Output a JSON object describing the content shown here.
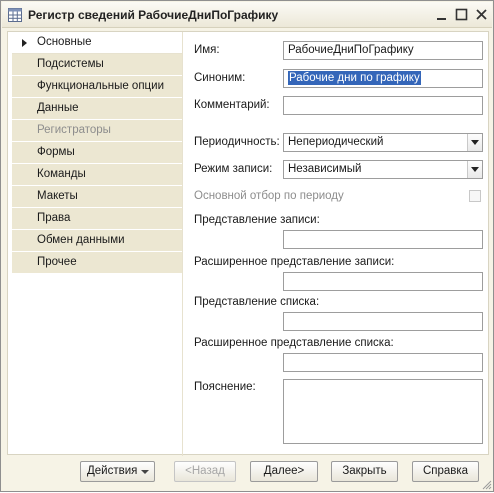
{
  "window": {
    "title": "Регистр сведений РабочиеДниПоГрафику"
  },
  "nav": {
    "items": [
      {
        "label": "Основные",
        "state": "active"
      },
      {
        "label": "Подсистемы",
        "state": "normal"
      },
      {
        "label": "Функциональные опции",
        "state": "normal"
      },
      {
        "label": "Данные",
        "state": "normal"
      },
      {
        "label": "Регистраторы",
        "state": "disabled"
      },
      {
        "label": "Формы",
        "state": "normal"
      },
      {
        "label": "Команды",
        "state": "normal"
      },
      {
        "label": "Макеты",
        "state": "normal"
      },
      {
        "label": "Права",
        "state": "normal"
      },
      {
        "label": "Обмен данными",
        "state": "normal"
      },
      {
        "label": "Прочее",
        "state": "normal"
      }
    ]
  },
  "form": {
    "name_label": "Имя:",
    "name_value": "РабочиеДниПоГрафику",
    "synonym_label": "Синоним:",
    "synonym_value": "Рабочие дни по графику",
    "comment_label": "Комментарий:",
    "comment_value": "",
    "periodicity_label": "Периодичность:",
    "periodicity_value": "Непериодический",
    "write_mode_label": "Режим записи:",
    "write_mode_value": "Независимый",
    "period_filter_label": "Основной отбор по периоду",
    "period_filter_checked": false,
    "record_repr_label": "Представление записи:",
    "record_repr_value": "",
    "ext_record_repr_label": "Расширенное представление записи:",
    "ext_record_repr_value": "",
    "list_repr_label": "Представление списка:",
    "list_repr_value": "",
    "ext_list_repr_label": "Расширенное представление списка:",
    "ext_list_repr_value": "",
    "explanation_label": "Пояснение:",
    "explanation_value": ""
  },
  "footer": {
    "actions_label": "Действия",
    "back_label": "<Назад",
    "next_label": "Далее>",
    "close_label": "Закрыть",
    "help_label": "Справка"
  },
  "colors": {
    "selection": "#3466b9",
    "nav_bg": "#ece7d2",
    "window_bg": "#f6f3e6"
  }
}
